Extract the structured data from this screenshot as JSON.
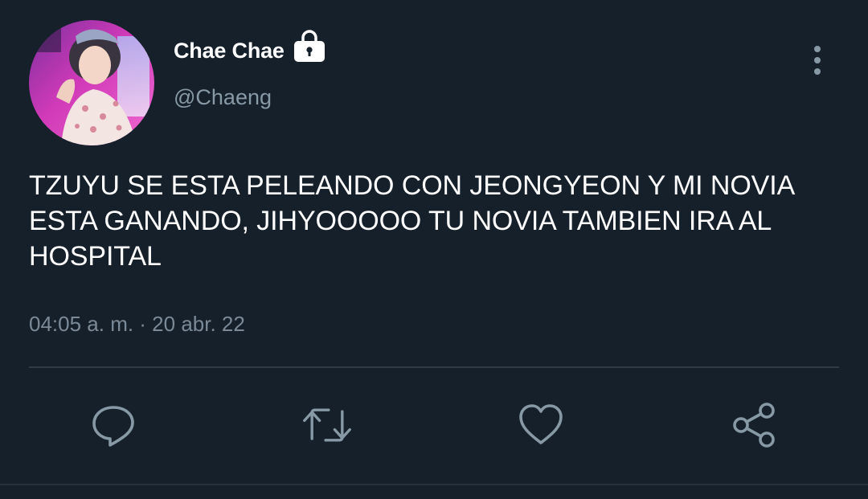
{
  "author": {
    "display_name": "Chae Chae",
    "handle": "@Chaeng",
    "protected": true,
    "avatar_icon": "profile-photo"
  },
  "tweet": {
    "text": "TZUYU SE ESTA PELEANDO CON JEONGYEON Y MI NOVIA\nESTA GANANDO, JIHYOOOOO TU NOVIA TAMBIEN IRA AL\nHOSPITAL",
    "timestamp": "04:05 a. m. · 20 abr. 22"
  },
  "actions": [
    {
      "icon": "reply-icon"
    },
    {
      "icon": "retweet-icon"
    },
    {
      "icon": "like-icon"
    },
    {
      "icon": "share-icon"
    }
  ],
  "colors": {
    "background": "#15202b",
    "primary_text": "#ffffff",
    "secondary_text": "#8899a6",
    "icon": "#8899a6",
    "divider": "#2f3b46"
  }
}
